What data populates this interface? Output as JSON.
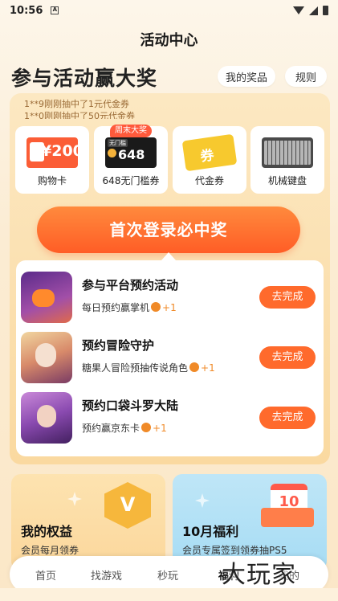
{
  "status_bar": {
    "time": "10:56",
    "notif_glyph": "A"
  },
  "title": "活动中心",
  "headline": "参与活动赢大奖",
  "buttons": {
    "my_prizes": "我的奖品",
    "rules": "规则"
  },
  "ticker": [
    "1**9刚刚抽中了1元代金券",
    "1**0刚刚抽中了50元代金券"
  ],
  "prizes": [
    {
      "label": "购物卡",
      "art_text": "¥200",
      "icon": "shopping-card-icon"
    },
    {
      "label": "648无门槛券",
      "art_text": "648",
      "art_tag": "无门槛",
      "badge": "周末大奖",
      "icon": "coupon-648-icon"
    },
    {
      "label": "代金券",
      "art_text": "券",
      "icon": "voucher-icon"
    },
    {
      "label": "机械键盘",
      "icon": "keyboard-icon"
    }
  ],
  "cta": "首次登录必中奖",
  "tasks": [
    {
      "title": "参与平台预约活动",
      "subtitle": "每日预约赢掌机",
      "reward": "+1",
      "action": "去完成"
    },
    {
      "title": "预约冒险守护",
      "subtitle": "糖果人冒险预抽传说角色",
      "reward": "+1",
      "action": "去完成"
    },
    {
      "title": "预约口袋斗罗大陆",
      "subtitle": "预约赢京东卡",
      "reward": "+1",
      "action": "去完成"
    }
  ],
  "benefits": [
    {
      "title": "我的权益",
      "subtitle": "会员每月领券",
      "art": "V"
    },
    {
      "title": "10月福利",
      "subtitle": "会员专属签到领券抽PS5",
      "art": "10"
    }
  ],
  "tabs": [
    "首页",
    "找游戏",
    "秒玩",
    "福利",
    "我的"
  ],
  "active_tab": "福利",
  "watermark": "大玩家"
}
